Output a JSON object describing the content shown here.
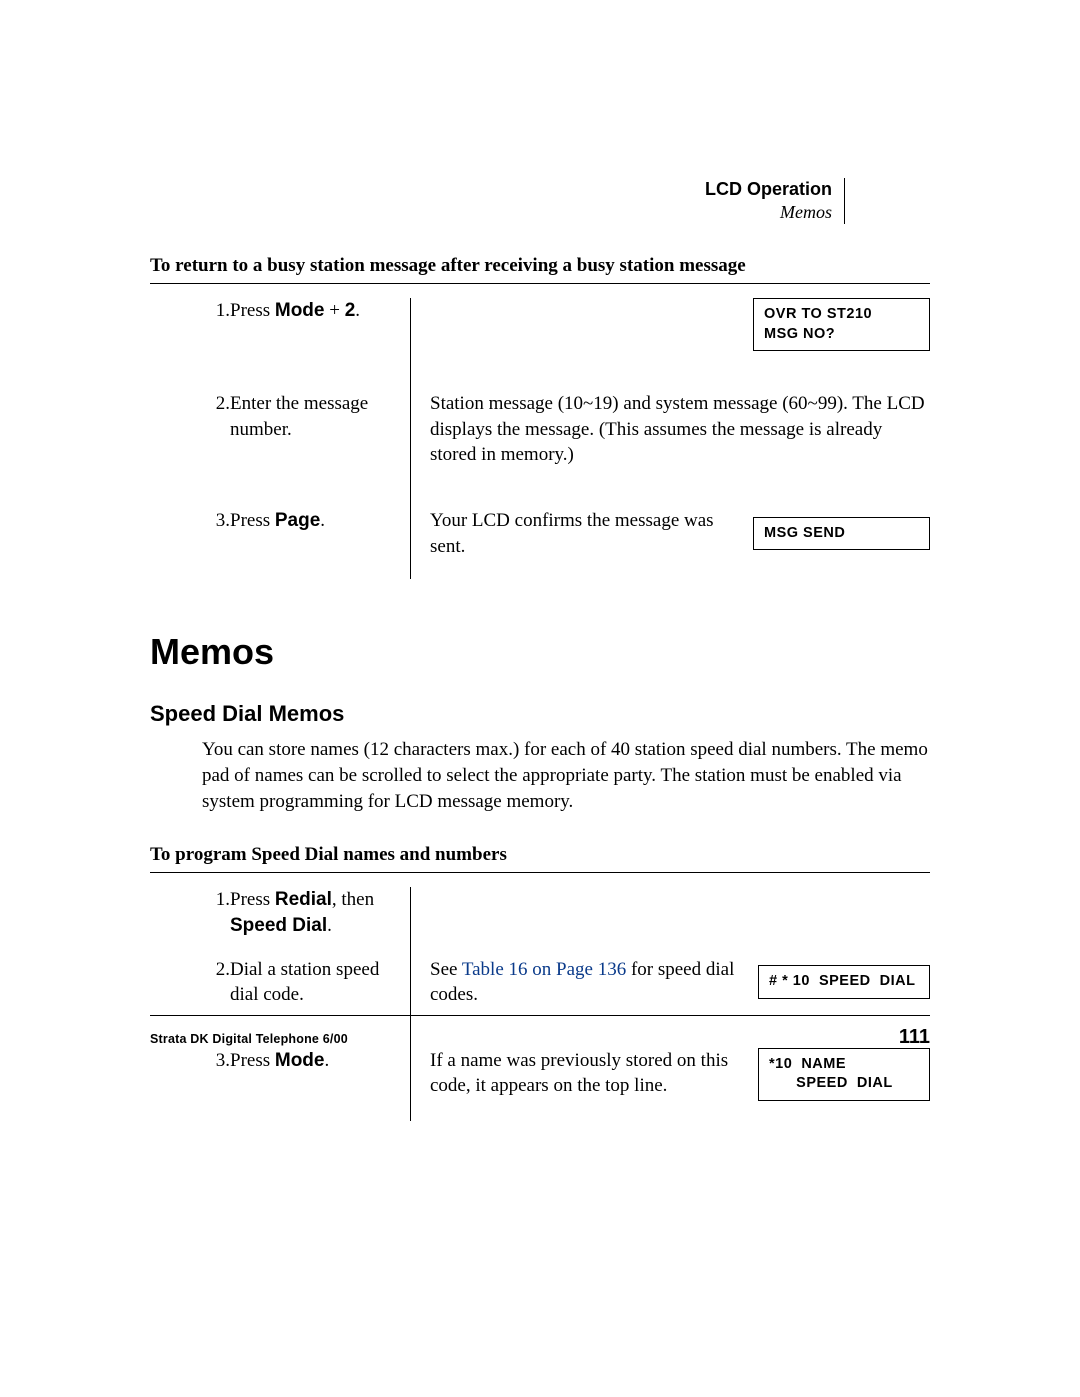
{
  "header": {
    "chapter": "LCD Operation",
    "section": "Memos"
  },
  "task1": {
    "title": "To return to a busy station message after receiving a busy station message",
    "steps": {
      "s1": {
        "num": "1.",
        "instr_pre": "Press ",
        "instr_kw": "Mode",
        "instr_post": " + ",
        "instr_kw2": "2",
        "instr_end": ".",
        "lcd_l1": "OVR TO ST210",
        "lcd_l2": "MSG NO?"
      },
      "s2": {
        "num": "2.",
        "instr": "Enter the message number.",
        "desc": "Station message (10~19) and system message (60~99). The LCD displays the message. (This assumes the message is already stored in memory.)"
      },
      "s3": {
        "num": "3.",
        "instr_pre": "Press ",
        "instr_kw": "Page",
        "instr_end": ".",
        "desc": "Your LCD confirms the message was sent.",
        "lcd_l1": "MSG SEND"
      }
    }
  },
  "h1": "Memos",
  "h2": "Speed Dial Memos",
  "para": "You can store names (12 characters max.) for each of 40 station speed dial numbers. The memo pad of names can be scrolled to select the appropriate party. The station must be enabled via system programming for LCD message memory.",
  "task2": {
    "title": "To program Speed Dial names and numbers",
    "steps": {
      "s1": {
        "num": "1.",
        "instr_pre": "Press ",
        "instr_kw": "Redial",
        "instr_mid": ", then ",
        "instr_kw2": "Speed Dial",
        "instr_end": "."
      },
      "s2": {
        "num": "2.",
        "instr": "Dial a station speed dial code.",
        "desc_pre": "See ",
        "desc_xref": "Table 16 on Page 136",
        "desc_post": " for speed dial codes.",
        "lcd_l1": "# * 10  SPEED  DIAL"
      },
      "s3": {
        "num": "3.",
        "instr_pre": "Press ",
        "instr_kw": "Mode",
        "instr_end": ".",
        "desc": "If a name was previously stored on this code, it appears on the top line.",
        "lcd_l1": "*10  NAME",
        "lcd_l2": "      SPEED  DIAL"
      }
    }
  },
  "footer": {
    "left": "Strata DK Digital Telephone   6/00",
    "right": "111"
  }
}
